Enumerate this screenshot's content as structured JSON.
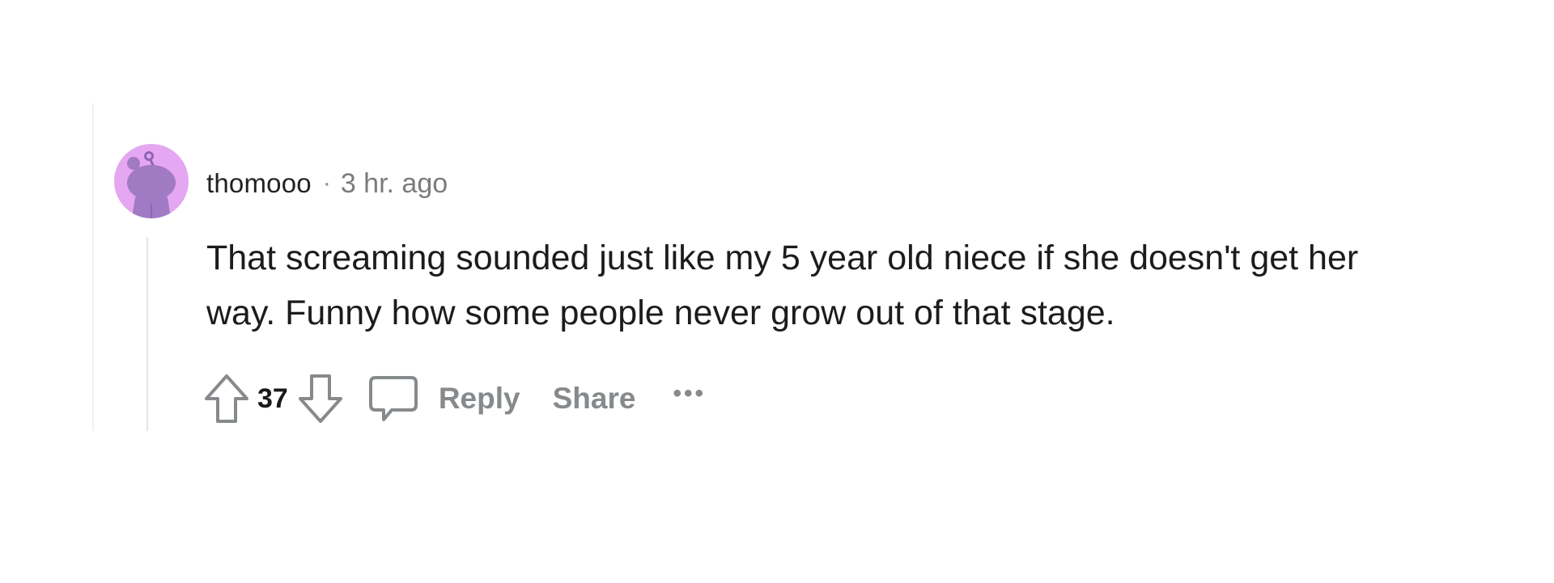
{
  "comment": {
    "username": "thomooo",
    "separator": "·",
    "timestamp": "3 hr. ago",
    "body": "That screaming sounded just like my 5 year old niece if she doesn't get her way. Funny how some people never grow out of that stage.",
    "avatar": {
      "icon": "snoo-avatar-icon",
      "background": "#e5a6f2"
    }
  },
  "actions": {
    "upvote_icon": "arrow-up-icon",
    "score": "37",
    "downvote_icon": "arrow-down-icon",
    "comment_icon": "speech-bubble-icon",
    "reply_label": "Reply",
    "share_label": "Share",
    "more_label": "•••"
  },
  "colors": {
    "text_primary": "#1c1c1c",
    "text_muted": "#878a8c",
    "avatar_bg": "#e5a6f2",
    "snoo_body": "#a07ac2"
  }
}
